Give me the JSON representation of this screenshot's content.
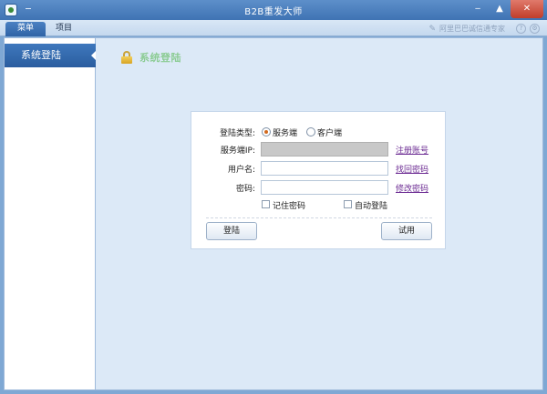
{
  "window": {
    "title": "B2B重发大师",
    "minimize_glyph": "‒",
    "maximize_glyph": "▲",
    "close_glyph": "✕",
    "icon_name": "app-logo-icon"
  },
  "tabs": [
    {
      "label": "菜单",
      "active": true
    },
    {
      "label": "项目",
      "active": false
    }
  ],
  "toolbar": {
    "notice_text": "阿里巴巴诚信通专家",
    "help_glyph": "?",
    "settings_glyph": "⚙"
  },
  "sidebar": {
    "items": [
      {
        "label": "系统登陆",
        "active": true
      }
    ]
  },
  "main": {
    "title": "系统登陆"
  },
  "login_form": {
    "type_label": "登陆类型:",
    "type_options": [
      {
        "label": "服务端",
        "selected": true
      },
      {
        "label": "客户端",
        "selected": false
      }
    ],
    "server_ip_label": "服务端IP:",
    "server_ip_value": "",
    "username_label": "用户名:",
    "username_value": "",
    "password_label": "密码:",
    "password_value": "",
    "register_link": "注册账号",
    "recover_link": "找回密码",
    "change_password_link": "修改密码",
    "remember_label": "记住密码",
    "remember_checked": false,
    "auto_login_label": "自动登陆",
    "auto_login_checked": false,
    "login_button": "登陆",
    "trial_button": "试用"
  },
  "colors": {
    "accent": "#2f63a6",
    "title_green": "#8ccc94",
    "link_purple": "#6b2a92",
    "selected_radio": "#d26a1f"
  }
}
